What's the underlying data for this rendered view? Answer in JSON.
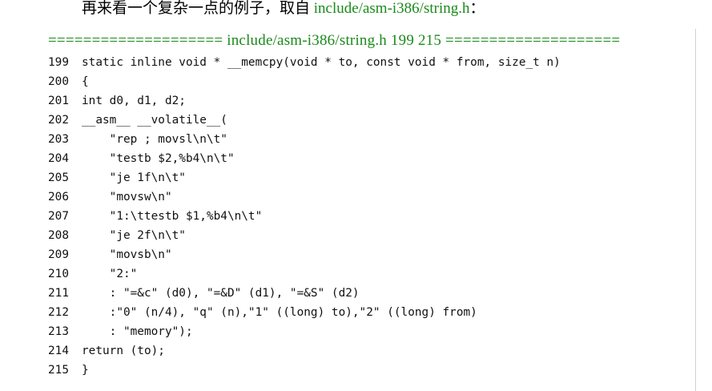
{
  "intro": {
    "prefix": "再来看一个复杂一点的例子，取自 ",
    "filename": "include/asm-i386/string.h",
    "suffix": "："
  },
  "separator": "==================== include/asm-i386/string.h 199 215 ====================",
  "code": [
    {
      "num": "199",
      "text": "static inline void * __memcpy(void * to, const void * from, size_t n)"
    },
    {
      "num": "200",
      "text": "{"
    },
    {
      "num": "201",
      "text": "int d0, d1, d2;"
    },
    {
      "num": "202",
      "text": "__asm__ __volatile__("
    },
    {
      "num": "203",
      "text": "    \"rep ; movsl\\n\\t\""
    },
    {
      "num": "204",
      "text": "    \"testb $2,%b4\\n\\t\""
    },
    {
      "num": "205",
      "text": "    \"je 1f\\n\\t\""
    },
    {
      "num": "206",
      "text": "    \"movsw\\n\""
    },
    {
      "num": "207",
      "text": "    \"1:\\ttestb $1,%b4\\n\\t\""
    },
    {
      "num": "208",
      "text": "    \"je 2f\\n\\t\""
    },
    {
      "num": "209",
      "text": "    \"movsb\\n\""
    },
    {
      "num": "210",
      "text": "    \"2:\""
    },
    {
      "num": "211",
      "text": "    : \"=&c\" (d0), \"=&D\" (d1), \"=&S\" (d2)"
    },
    {
      "num": "212",
      "text": "    :\"0\" (n/4), \"q\" (n),\"1\" ((long) to),\"2\" ((long) from)"
    },
    {
      "num": "213",
      "text": "    : \"memory\");"
    },
    {
      "num": "214",
      "text": "return (to);"
    },
    {
      "num": "215",
      "text": "}"
    }
  ]
}
